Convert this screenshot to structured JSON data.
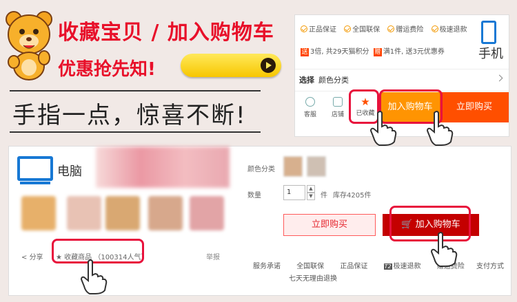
{
  "promo": {
    "headline1": "收藏宝贝 / 加入购物车",
    "headline2": "优惠抢先知!",
    "slogan": "手指一点，惊喜不断!"
  },
  "mobile": {
    "guarantees": [
      "正品保证",
      "全国联保",
      "赠运费险",
      "极速退款"
    ],
    "promo_text": "3倍, 共29天猫积分",
    "promo_text2": "满1件, 送3元优惠券",
    "device_label": "手机",
    "select_label": "选择",
    "select_value": "颜色分类",
    "tool_service": "客服",
    "tool_store": "店铺",
    "tool_favorite": "已收藏",
    "add_cart": "加入购物车",
    "buy_now": "立即购买"
  },
  "desktop": {
    "device_label": "电脑",
    "share": "分享",
    "collect": "收藏商品 （100314人气）",
    "report": "举报",
    "color_label": "颜色分类",
    "qty_label": "数量",
    "qty_value": "1",
    "qty_unit": "件",
    "stock": "库存4205件",
    "buy_now": "立即购买",
    "add_cart": "加入购物车",
    "service_label": "服务承诺",
    "services": [
      "全国联保",
      "正品保证",
      "极速退款",
      "赠运费险"
    ],
    "tmall_badge": "T2",
    "payment": "支付方式",
    "no_reason": "七天无理由退换"
  },
  "colors": {
    "brand_red": "#e8102a",
    "accent_orange": "#ff9402",
    "buy_orange": "#ff4f00",
    "tmall_red": "#c40000",
    "device_blue": "#1778d4"
  }
}
